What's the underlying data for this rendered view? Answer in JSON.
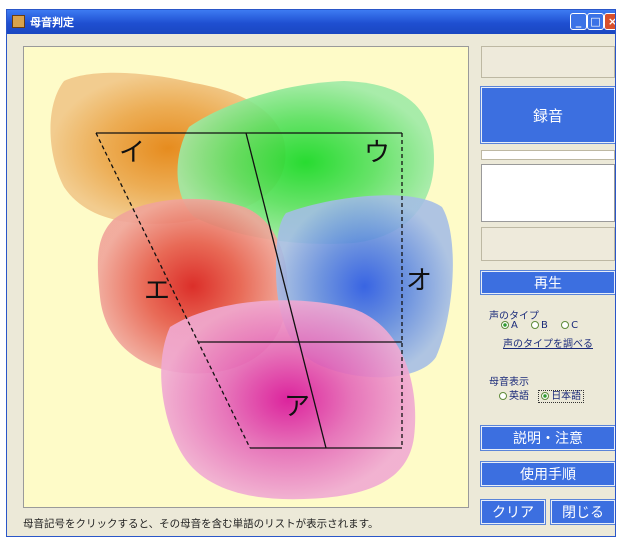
{
  "window": {
    "title": "母音判定"
  },
  "chart": {
    "vowels": [
      {
        "label": "イ",
        "color": "#e88a18"
      },
      {
        "label": "ウ",
        "color": "#18d828"
      },
      {
        "label": "エ",
        "color": "#e02020"
      },
      {
        "label": "オ",
        "color": "#2858e8"
      },
      {
        "label": "ア",
        "color": "#e010a0"
      }
    ]
  },
  "buttons": {
    "record": "録音",
    "play": "再生",
    "explain": "説明・注意",
    "usage": "使用手順",
    "clear": "クリア",
    "close": "閉じる"
  },
  "voice_type": {
    "label": "声のタイプ",
    "options": [
      "A",
      "B",
      "C"
    ],
    "selected": "A",
    "link": "声のタイプを調べる"
  },
  "vowel_display": {
    "label": "母音表示",
    "options": [
      "英語",
      "日本語"
    ],
    "selected": "日本語"
  },
  "status_text": "母音記号をクリックすると、その母音を含む単語のリストが表示されます。"
}
